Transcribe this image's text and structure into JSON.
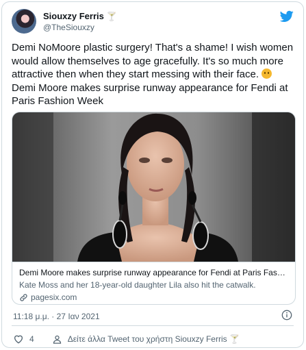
{
  "author": {
    "display_name": "Siouxzy Ferris",
    "name_emoji": "🍸",
    "handle": "@TheSiouxzy"
  },
  "tweet": {
    "text": "Demi NoMoore plastic surgery! That's a shame! I wish women would allow themselves to age gracefully. It's so much more attractive then when they start messing with their face. ",
    "text_tail": "\nDemi Moore makes surprise runway appearance for Fendi at Paris Fashion Week"
  },
  "card": {
    "title": "Demi Moore makes surprise runway appearance for Fendi at Paris Fashio…",
    "description": "Kate Moss and her 18-year-old daughter Lila also hit the catwalk.",
    "domain": "pagesix.com"
  },
  "meta": {
    "timestamp": "11:18 μ.μ. · 27 Ιαν 2021"
  },
  "actions": {
    "like_count": "4",
    "more_link": "Δείτε άλλα Tweet του χρήστη Siouxzy Ferris 🍸"
  },
  "colors": {
    "twitter_blue": "#1d9bf0",
    "secondary_text": "#536471",
    "border": "#cfd9de"
  }
}
